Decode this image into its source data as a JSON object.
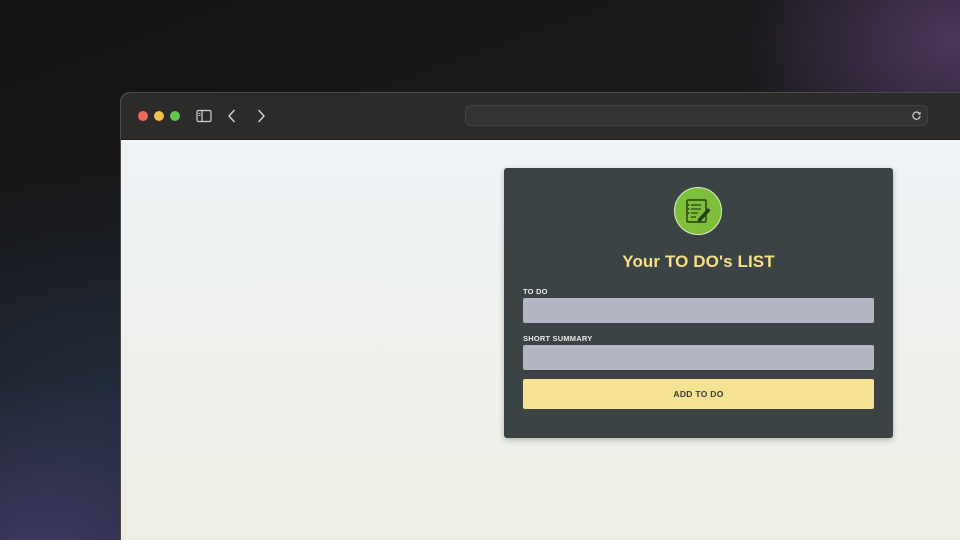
{
  "browser": {
    "address": "",
    "icons": {
      "sidebar": "sidebar-icon",
      "back": "chevron-left-icon",
      "forward": "chevron-right-icon",
      "reload": "reload-icon"
    }
  },
  "app": {
    "title": "Your TO DO's LIST",
    "logo_icon": "notepad-pencil-icon",
    "fields": {
      "todo_label": "TO DO",
      "todo_value": "",
      "summary_label": "SHORT SUMMARY",
      "summary_value": ""
    },
    "add_button_label": "ADD TO DO"
  },
  "colors": {
    "card_bg": "#3c4345",
    "title": "#f6df86",
    "input_bg": "#b4b5c4",
    "button_bg": "#f6e293",
    "logo_bg": "#7dbf3a"
  }
}
